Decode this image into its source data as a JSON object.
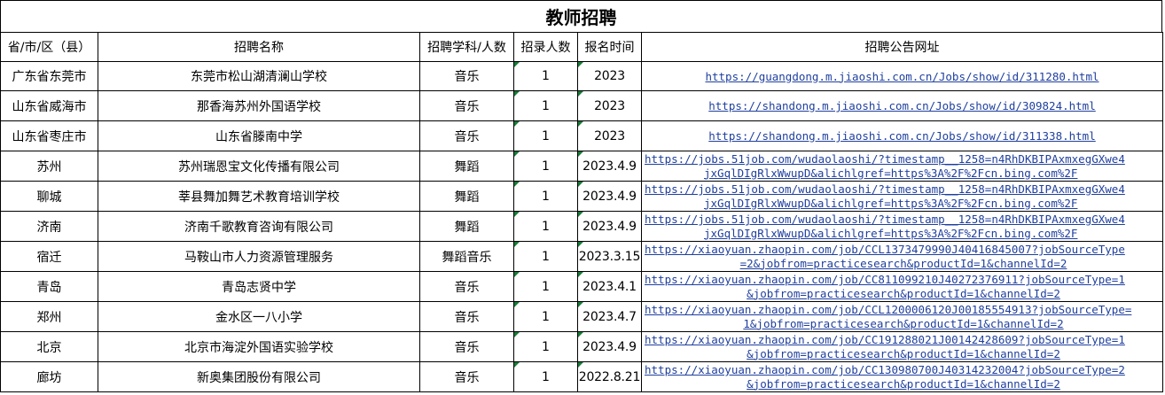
{
  "title": "教师招聘",
  "headers": [
    "省/市/区（县）",
    "招聘名称",
    "招聘学科/人数",
    "招录人数",
    "报名时间",
    "招聘公告网址"
  ],
  "rows": [
    {
      "region": "广东省东莞市",
      "name": "东莞市松山湖清澜山学校",
      "subject": "音乐",
      "count": "1",
      "date": "2023",
      "url1": "https://guangdong.m.jiaoshi.com.cn/Jobs/show/id/311280.html",
      "url2": ""
    },
    {
      "region": "山东省威海市",
      "name": "那香海苏州外国语学校",
      "subject": "音乐",
      "count": "1",
      "date": "2023",
      "url1": "https://shandong.m.jiaoshi.com.cn/Jobs/show/id/309824.html",
      "url2": ""
    },
    {
      "region": "山东省枣庄市",
      "name": "山东省滕南中学",
      "subject": "音乐",
      "count": "1",
      "date": "2023",
      "url1": "https://shandong.m.jiaoshi.com.cn/Jobs/show/id/311338.html",
      "url2": ""
    },
    {
      "region": "苏州",
      "name": "苏州瑞恩宝文化传播有限公司",
      "subject": "舞蹈",
      "count": "1",
      "date": "2023.4.9",
      "url1": "https://jobs.51job.com/wudaolaoshi/?timestamp__1258=n4RhDKBIPAxmxegGXwe4",
      "url2": "jxGqlDIgRlxWwupD&alichlgref=https%3A%2F%2Fcn.bing.com%2F"
    },
    {
      "region": "聊城",
      "name": "莘县舞加舞艺术教育培训学校",
      "subject": "舞蹈",
      "count": "1",
      "date": "2023.4.9",
      "url1": "https://jobs.51job.com/wudaolaoshi/?timestamp__1258=n4RhDKBIPAxmxegGXwe4",
      "url2": "jxGqlDIgRlxWwupD&alichlgref=https%3A%2F%2Fcn.bing.com%2F"
    },
    {
      "region": "济南",
      "name": "济南千歌教育咨询有限公司",
      "subject": "舞蹈",
      "count": "1",
      "date": "2023.4.9",
      "url1": "https://jobs.51job.com/wudaolaoshi/?timestamp__1258=n4RhDKBIPAxmxegGXwe4",
      "url2": "jxGqlDIgRlxWwupD&alichlgref=https%3A%2F%2Fcn.bing.com%2F"
    },
    {
      "region": "宿迁",
      "name": "马鞍山市人力资源管理服务",
      "subject": "舞蹈音乐",
      "count": "1",
      "date": "2023.3.15",
      "url1": "https://xiaoyuan.zhaopin.com/job/CCL1373479990J40416845007?jobSourceType",
      "url2": "=2&jobfrom=practicesearch&productId=1&channelId=2"
    },
    {
      "region": "青岛",
      "name": "青岛志贤中学",
      "subject": "音乐",
      "count": "1",
      "date": "2023.4.1",
      "url1": "https://xiaoyuan.zhaopin.com/job/CC811099210J40272376911?jobSourceType=1",
      "url2": "&jobfrom=practicesearch&productId=1&channelId=2"
    },
    {
      "region": "郑州",
      "name": "金水区一八小学",
      "subject": "音乐",
      "count": "1",
      "date": "2023.4.7",
      "url1": "https://xiaoyuan.zhaopin.com/job/CCL1200006120J00185554913?jobSourceType=",
      "url2": "1&jobfrom=practicesearch&productId=1&channelId=2"
    },
    {
      "region": "北京",
      "name": "北京市海淀外国语实验学校",
      "subject": "音乐",
      "count": "1",
      "date": "2023.4.9",
      "url1": "https://xiaoyuan.zhaopin.com/job/CC191288021J00142428609?jobSourceType=1",
      "url2": "&jobfrom=practicesearch&productId=1&channelId=2"
    },
    {
      "region": "廊坊",
      "name": "新奥集团股份有限公司",
      "subject": "音乐",
      "count": "1",
      "date": "2022.8.21",
      "url1": "https://xiaoyuan.zhaopin.com/job/CC130980700J40314232004?jobSourceType=2",
      "url2": "&jobfrom=practicesearch&productId=1&channelId=2"
    }
  ]
}
